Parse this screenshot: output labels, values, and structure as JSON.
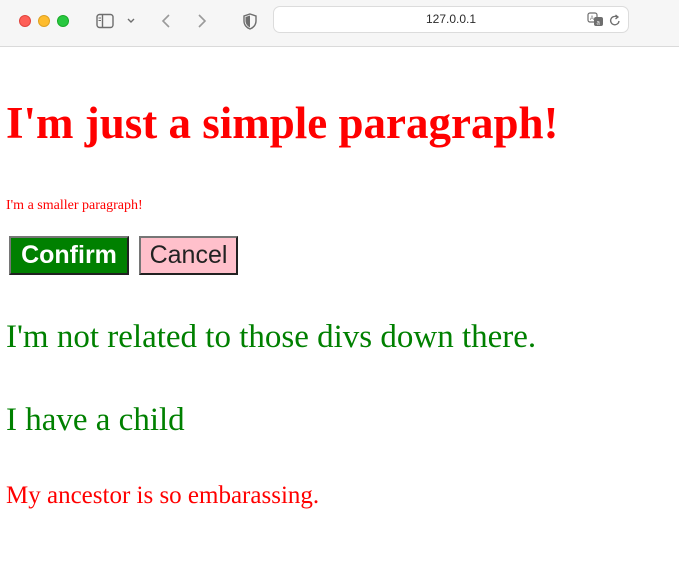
{
  "browser": {
    "url": "127.0.0.1",
    "icons": {
      "sidebar": "sidebar-toggle-icon",
      "chevron": "chevron-down-icon",
      "back": "back-arrow-icon",
      "forward": "forward-arrow-icon",
      "shield": "privacy-shield-icon",
      "translate": "translate-icon",
      "reload": "reload-icon"
    }
  },
  "page": {
    "heading": "I'm just a simple paragraph!",
    "small_paragraph": "I'm a smaller paragraph!",
    "buttons": {
      "confirm": "Confirm",
      "cancel": "Cancel"
    },
    "unrelated_paragraph": "I'm not related to those divs down there.",
    "parent_paragraph": "I have a child",
    "child_paragraph": "My ancestor is so embarassing."
  },
  "colors": {
    "heading": "#ff0000",
    "small_paragraph": "#ff0000",
    "confirm_bg": "#008000",
    "cancel_bg": "#ffc0cb",
    "green_text": "#008000",
    "child_text": "#ff0000"
  }
}
